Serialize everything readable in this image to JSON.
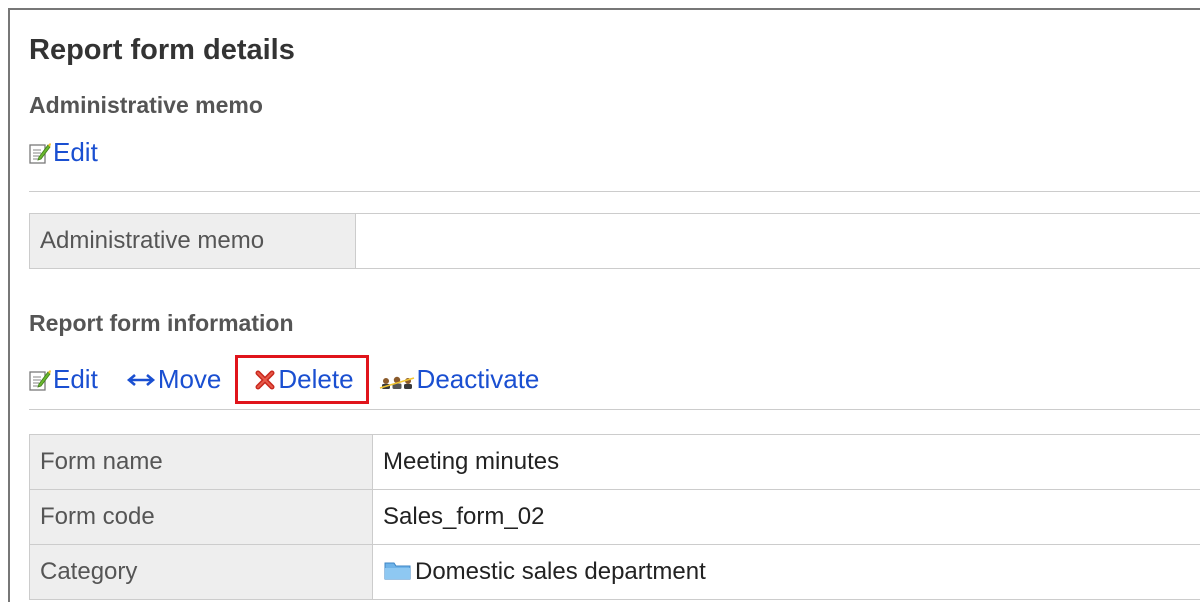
{
  "page": {
    "title": "Report form details"
  },
  "admin_memo": {
    "heading": "Administrative memo",
    "edit_label": "Edit",
    "table": [
      {
        "label": "Administrative memo",
        "value": ""
      }
    ]
  },
  "report_info": {
    "heading": "Report form information",
    "actions": {
      "edit_label": "Edit",
      "move_label": "Move",
      "delete_label": "Delete",
      "deactivate_label": "Deactivate"
    },
    "table": [
      {
        "label": "Form name",
        "value": "Meeting minutes"
      },
      {
        "label": "Form code",
        "value": "Sales_form_02"
      },
      {
        "label": "Category",
        "value": "Domestic sales department"
      }
    ]
  },
  "colors": {
    "link": "#1a4fd1",
    "highlight": "#e0141b",
    "label_bg": "#eeeeee"
  },
  "icons": [
    "edit-icon",
    "move-arrows-icon",
    "delete-x-icon",
    "deactivate-users-icon",
    "folder-icon"
  ]
}
